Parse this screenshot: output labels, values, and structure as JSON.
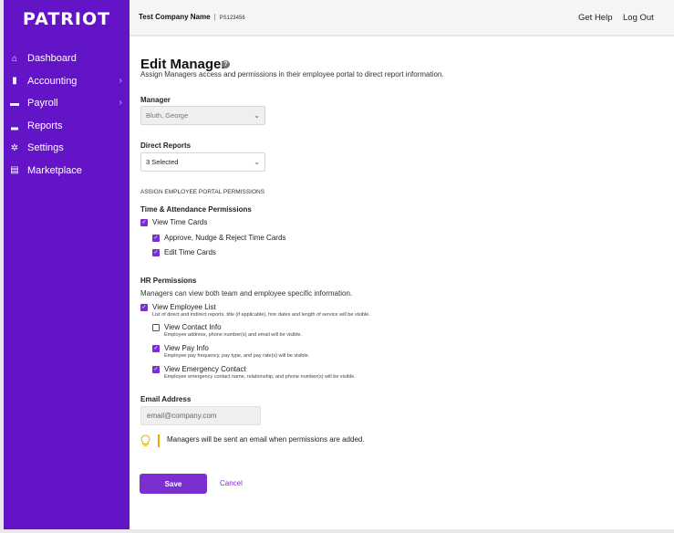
{
  "brand": {
    "logo": "PATRIOT",
    "sidebar_color": "#6314c7",
    "accent_color": "#7a2fd0"
  },
  "sidebar": {
    "items": [
      {
        "label": "Dashboard",
        "icon": "home-icon",
        "glyph": "⌂",
        "has_chevron": false
      },
      {
        "label": "Accounting",
        "icon": "book-icon",
        "glyph": "▮",
        "has_chevron": true
      },
      {
        "label": "Payroll",
        "icon": "money-icon",
        "glyph": "▬",
        "has_chevron": true
      },
      {
        "label": "Reports",
        "icon": "bar-chart-icon",
        "glyph": "▂",
        "has_chevron": false
      },
      {
        "label": "Settings",
        "icon": "gear-icon",
        "glyph": "✲",
        "has_chevron": false
      },
      {
        "label": "Marketplace",
        "icon": "storefront-icon",
        "glyph": "▤",
        "has_chevron": false
      }
    ],
    "chevron": "›"
  },
  "header": {
    "company_name": "Test Company Name",
    "separator": "|",
    "company_id": "PS123456",
    "help_label": "Get Help",
    "logout_label": "Log Out"
  },
  "page": {
    "title": "Edit Manager",
    "help_glyph": "?",
    "subtitle": "Assign Managers access and permissions in their employee portal to direct report information."
  },
  "manager": {
    "label": "Manager",
    "value": "Bluth, George"
  },
  "direct_reports": {
    "label": "Direct Reports",
    "value": "3 Selected"
  },
  "select_chevron": "⌄",
  "section_caps": "ASSIGN EMPLOYEE PORTAL PERMISSIONS",
  "time_attendance": {
    "heading": "Time & Attendance Permissions",
    "items": [
      {
        "label": "View Time Cards",
        "checked": true
      },
      {
        "label": "Approve, Nudge & Reject Time Cards",
        "checked": true
      },
      {
        "label": "Edit Time Cards",
        "checked": true
      }
    ]
  },
  "hr": {
    "heading": "HR Permissions",
    "note": "Managers can view both team and employee specific information.",
    "items": [
      {
        "label": "View Employee List",
        "desc": "List of direct and indirect reports, title (if applicable), hire dates and length of service will be visible.",
        "checked": true
      },
      {
        "label": "View Contact Info",
        "desc": "Employee address, phone number(s) and email will be visible.",
        "checked": false
      },
      {
        "label": "View Pay Info",
        "desc": "Employee pay frequency, pay type, and pay rate(s) will be visible.",
        "checked": true
      },
      {
        "label": "View Emergency Contact",
        "desc": "Employee emergency contact name, relationship, and phone number(s) will be visible.",
        "checked": true
      }
    ]
  },
  "check_glyph": "✓",
  "email": {
    "label": "Email Address",
    "placeholder": "email@company.com"
  },
  "info": {
    "icon": "lightbulb-icon",
    "text": "Managers will be sent an email when permissions are added."
  },
  "actions": {
    "save_label": "Save",
    "cancel_label": "Cancel"
  }
}
